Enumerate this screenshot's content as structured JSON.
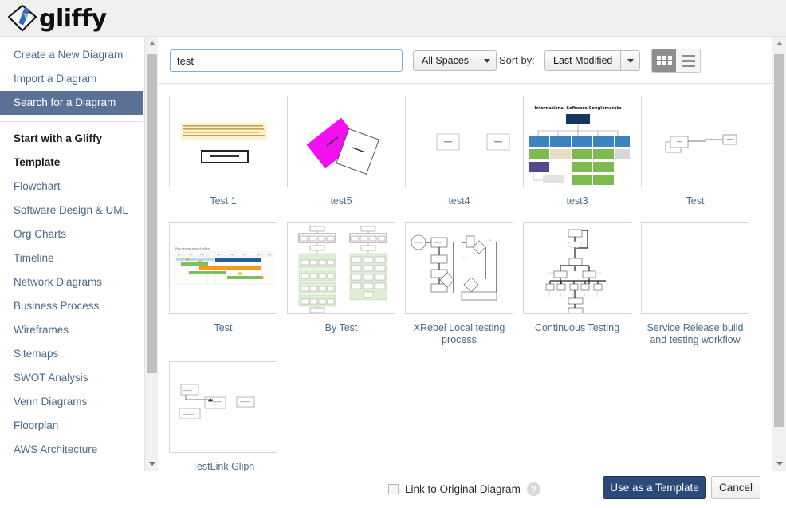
{
  "app": {
    "logo_text": "gliffy",
    "logo_icon": "gliffy-diamond-arrow-logo"
  },
  "sidebar": {
    "actions": [
      {
        "label": "Create a New Diagram",
        "name": "create-a-new-diagram",
        "selected": false
      },
      {
        "label": "Import a Diagram",
        "name": "import-a-diagram",
        "selected": false
      },
      {
        "label": "Search for a Diagram",
        "name": "search-for-a-diagram",
        "selected": true
      }
    ],
    "heading_line1": "Start with a Gliffy",
    "heading_line2": "Template",
    "templates": [
      {
        "label": "Flowchart",
        "name": "flowchart"
      },
      {
        "label": "Software Design & UML",
        "name": "software-design-uml"
      },
      {
        "label": "Org Charts",
        "name": "org-charts"
      },
      {
        "label": "Timeline",
        "name": "timeline"
      },
      {
        "label": "Network Diagrams",
        "name": "network-diagrams"
      },
      {
        "label": "Business Process",
        "name": "business-process"
      },
      {
        "label": "Wireframes",
        "name": "wireframes"
      },
      {
        "label": "Sitemaps",
        "name": "sitemaps"
      },
      {
        "label": "SWOT Analysis",
        "name": "swot-analysis"
      },
      {
        "label": "Venn Diagrams",
        "name": "venn-diagrams"
      },
      {
        "label": "Floorplan",
        "name": "floorplan"
      },
      {
        "label": "AWS Architecture",
        "name": "aws-architecture"
      }
    ]
  },
  "toolbar": {
    "search_value": "test",
    "search_placeholder": "",
    "spaces_filter": "All Spaces",
    "sort_by_label": "Sort by:",
    "sort_by_value": "Last Modified",
    "view_grid_icon": "grid-view-icon",
    "view_list_icon": "list-view-icon",
    "active_view": "grid"
  },
  "results": {
    "rows": [
      [
        {
          "title": "Test 1",
          "thumb": "main-topic-note"
        },
        {
          "title": "test5",
          "thumb": "magenta-rotated-shapes"
        },
        {
          "title": "test4",
          "thumb": "single-small-box"
        },
        {
          "title": "test3",
          "thumb": "org-chart-colored"
        },
        {
          "title": "Test",
          "thumb": "two-boxes-connector"
        }
      ],
      [
        {
          "title": "Test",
          "thumb": "gantt-timeline"
        },
        {
          "title": "By Test",
          "thumb": "green-process-flow"
        },
        {
          "title": "XRebel Local testing process",
          "thumb": "network-flow-diagram"
        },
        {
          "title": "Continuous Testing",
          "thumb": "tree-flowchart"
        },
        {
          "title": "Service Release build and testing workflow",
          "thumb": "empty-thumbnail"
        }
      ],
      [
        {
          "title": "TestLink Gliph",
          "thumb": "testlink-boxes"
        }
      ]
    ]
  },
  "footer": {
    "link_original_label": "Link to Original Diagram",
    "link_original_checked": false,
    "help_label": "?",
    "primary_button": "Use as a Template",
    "secondary_button": "Cancel"
  },
  "colors": {
    "sidebar_selected_bg": "#5b7196",
    "link_text": "#49698c",
    "primary_button_bg": "#2a4b78",
    "search_border": "#7aaef0",
    "header_bg": "#f0f0f0"
  }
}
